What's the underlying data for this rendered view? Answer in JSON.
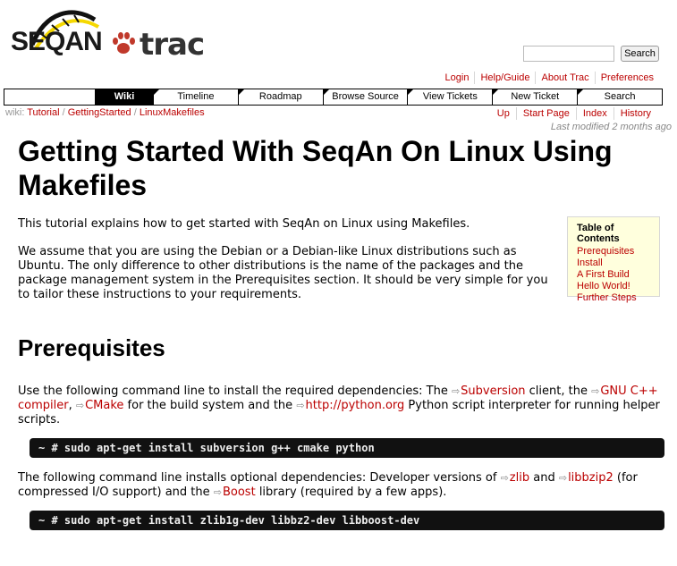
{
  "header": {
    "logo_text": "SEQAN",
    "logo_trac": "trac",
    "search_placeholder": "",
    "search_button": "Search"
  },
  "metanav": [
    "Login",
    "Help/Guide",
    "About Trac",
    "Preferences"
  ],
  "mainnav": [
    "Wiki",
    "Timeline",
    "Roadmap",
    "Browse Source",
    "View Tickets",
    "New Ticket",
    "Search"
  ],
  "breadcrumb": {
    "prefix": "wiki:",
    "parts": [
      "Tutorial",
      "GettingStarted",
      "LinuxMakefiles"
    ],
    "sep": "/"
  },
  "ctxtnav": [
    "Up",
    "Start Page",
    "Index",
    "History"
  ],
  "last_modified": {
    "prefix": "Last modified",
    "age": "2 months ago"
  },
  "content": {
    "title": "Getting Started With SeqAn On Linux Using Makefiles",
    "intro": "This tutorial explains how to get started with SeqAn on Linux using Makefiles.",
    "assume": "We assume that you are using the Debian or a Debian-like Linux distributions such as Ubuntu. The only difference to other distributions is the name of the packages and the package management system in the Prerequisites section. It should be very simple for you to tailor these instructions to your requirements.",
    "section_title": "Prerequisites",
    "prereq": {
      "t1": "Use the following command line to install the required dependencies: The ",
      "link1": "Subversion",
      "t2": " client, the ",
      "link2": "GNU C++ compiler",
      "t3": ", ",
      "link3": "CMake",
      "t4": " for the build system and the ",
      "link4": "http://python.org",
      "t5": " Python script interpreter for running helper scripts."
    },
    "code1": "~ # sudo apt-get install subversion g++ cmake python",
    "optional": {
      "t1": "The following command line installs optional dependencies: Developer versions of ",
      "link1": "zlib",
      "t2": " and ",
      "link2": "libbzip2",
      "t3": " (for compressed I/O support) and the ",
      "link3": "Boost",
      "t4": " library (required by a few apps)."
    },
    "code2": "~ # sudo apt-get install zlib1g-dev libbz2-dev libboost-dev"
  },
  "toc": {
    "title": "Table of Contents",
    "items": [
      "Prerequisites",
      "Install",
      "A First Build",
      "Hello World!",
      "Further Steps"
    ]
  },
  "colors": {
    "link": "#bb0000",
    "code_bg": "#111111",
    "toc_bg": "#ffffdd",
    "logo_yellow": "#f5d800"
  },
  "icons": [
    "dna-helix-logo-icon",
    "paw-icon",
    "external-link-icon"
  ]
}
